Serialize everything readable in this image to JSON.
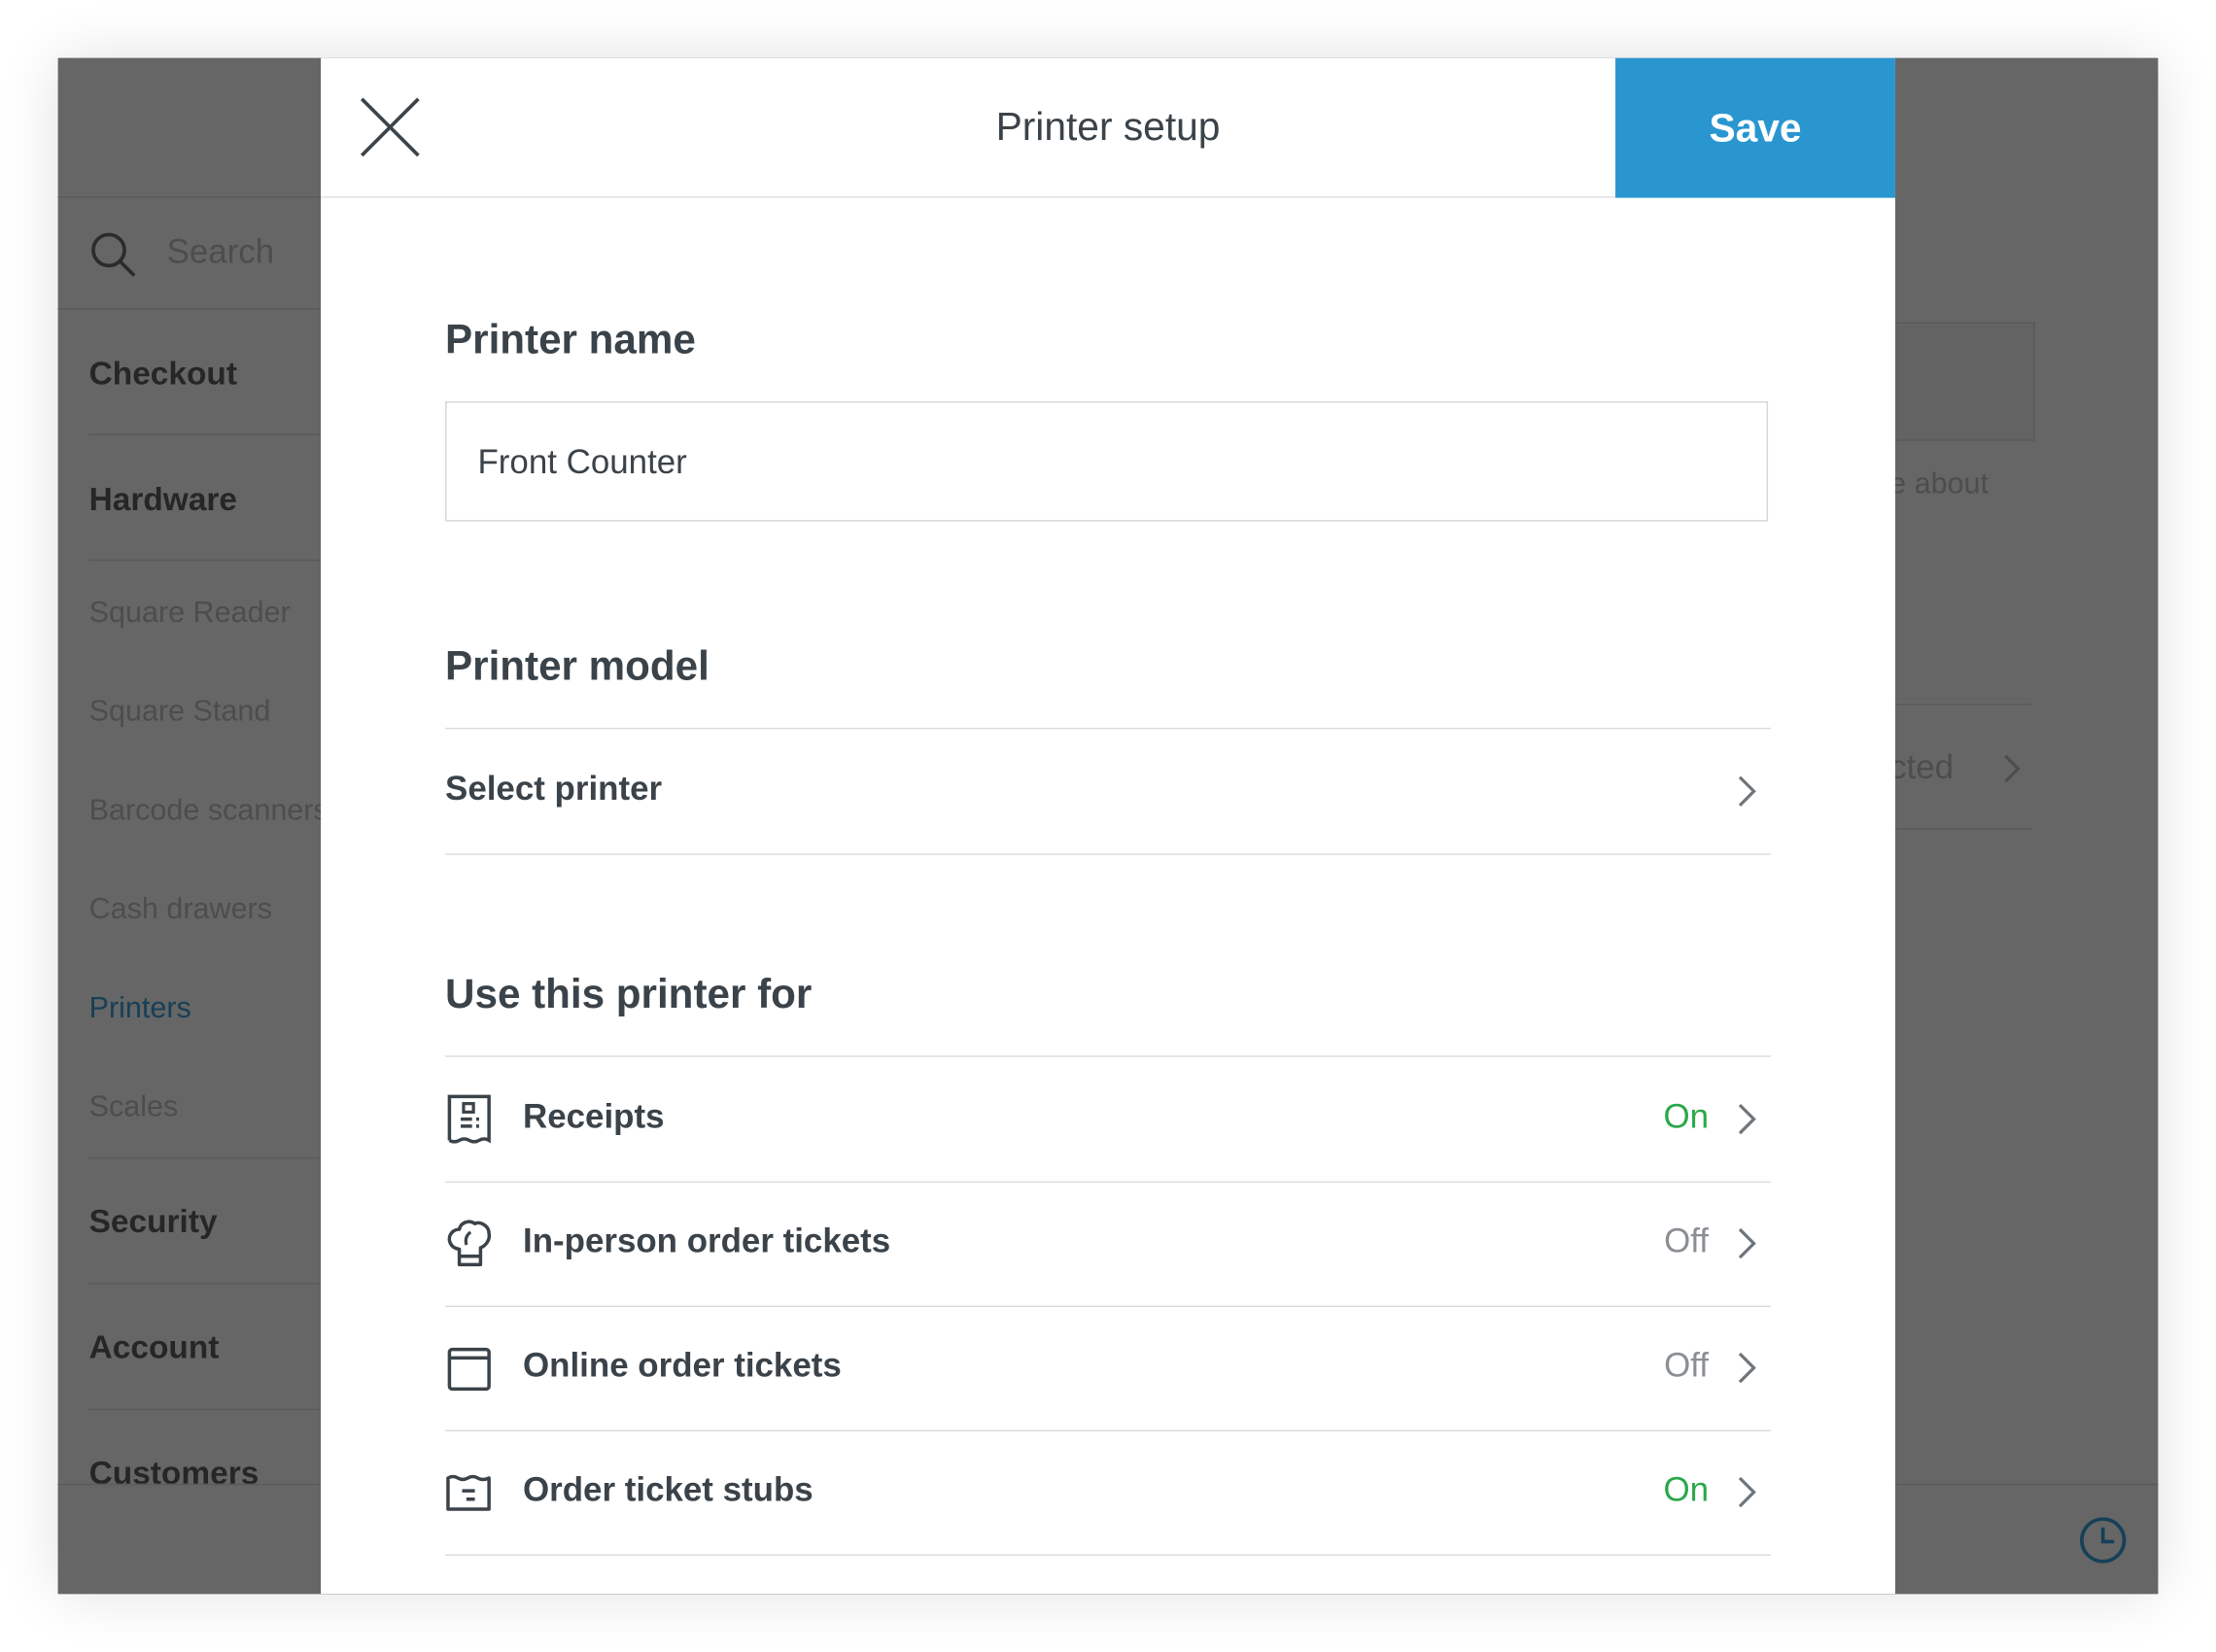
{
  "sidebar": {
    "search_placeholder": "Search",
    "items": [
      {
        "label": "Checkout",
        "type": "main"
      },
      {
        "label": "Hardware",
        "type": "main"
      },
      {
        "label": "Square Reader",
        "type": "sub"
      },
      {
        "label": "Square Stand",
        "type": "sub"
      },
      {
        "label": "Barcode scanners",
        "type": "sub"
      },
      {
        "label": "Cash drawers",
        "type": "sub"
      },
      {
        "label": "Printers",
        "type": "active"
      },
      {
        "label": "Scales",
        "type": "sub"
      },
      {
        "label": "Security",
        "type": "main"
      },
      {
        "label": "Account",
        "type": "main"
      },
      {
        "label": "Customers",
        "type": "main"
      }
    ]
  },
  "background": {
    "fragment_text": "e about",
    "fragment_row": "cted"
  },
  "modal": {
    "title": "Printer setup",
    "save_label": "Save",
    "printer_name": {
      "heading": "Printer name",
      "value": "Front Counter"
    },
    "printer_model": {
      "heading": "Printer model",
      "select_label": "Select printer"
    },
    "use_for": {
      "heading": "Use this printer for",
      "items": [
        {
          "label": "Receipts",
          "status": "On",
          "icon": "receipt-icon"
        },
        {
          "label": "In-person order tickets",
          "status": "Off",
          "icon": "chef-hat-icon"
        },
        {
          "label": "Online order tickets",
          "status": "Off",
          "icon": "browser-window-icon"
        },
        {
          "label": "Order ticket stubs",
          "status": "On",
          "icon": "ticket-stub-icon"
        }
      ]
    }
  },
  "colors": {
    "accent": "#2a96d0",
    "on": "#2aa84a",
    "off": "#8a8f94",
    "text": "#3b434a",
    "active_nav": "#164058"
  }
}
